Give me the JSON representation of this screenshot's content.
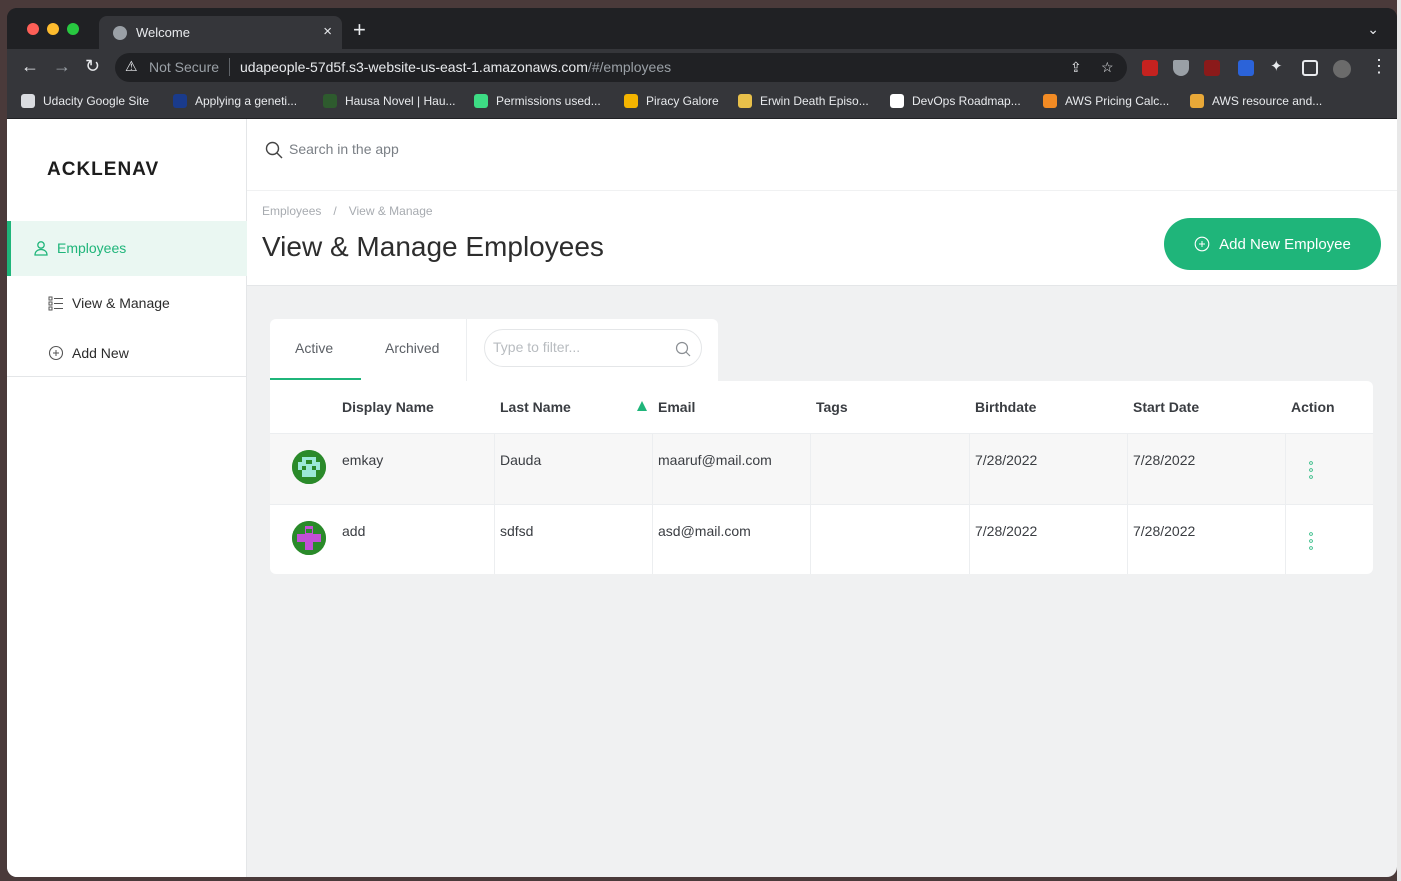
{
  "browser": {
    "tab_title": "Welcome",
    "tab_close": "×",
    "new_tab": "+",
    "security_label": "Not Secure",
    "url_host": "udapeople-57d5f.s3-website-us-east-1.amazonaws.com",
    "url_path": "/#/employees",
    "bookmarks": [
      {
        "label": "Udacity Google Site",
        "color": "#dadce0"
      },
      {
        "label": "Applying a geneti...",
        "color": "#1a3b8c"
      },
      {
        "label": "Hausa Novel | Hau...",
        "color": "#2e5b2e"
      },
      {
        "label": "Permissions used...",
        "color": "#3ddc84"
      },
      {
        "label": "Piracy Galore",
        "color": "#f4b400"
      },
      {
        "label": "Erwin Death Episo...",
        "color": "#e8c04a"
      },
      {
        "label": "DevOps Roadmap...",
        "color": "#ffffff"
      },
      {
        "label": "AWS Pricing Calc...",
        "color": "#f28b24"
      },
      {
        "label": "AWS resource and...",
        "color": "#e8a838"
      }
    ]
  },
  "app": {
    "logo": "ACKLENAV",
    "search_placeholder": "Search in the app",
    "sidebar": {
      "parent": "Employees",
      "items": [
        {
          "label": "View & Manage"
        },
        {
          "label": "Add New"
        }
      ]
    },
    "breadcrumb": [
      "Employees",
      "View & Manage"
    ],
    "breadcrumb_sep": "/",
    "title": "View & Manage Employees",
    "add_button": "Add New Employee",
    "tabs": [
      "Active",
      "Archived"
    ],
    "filter_placeholder": "Type to filter...",
    "table": {
      "columns": [
        "Display Name",
        "Last Name",
        "Email",
        "Tags",
        "Birthdate",
        "Start Date",
        "Action"
      ],
      "sorted_column": "Email",
      "rows": [
        {
          "display_name": "emkay",
          "last_name": "Dauda",
          "email": "maaruf@mail.com",
          "tags": "",
          "birthdate": "7/28/2022",
          "start_date": "7/28/2022"
        },
        {
          "display_name": "add",
          "last_name": "sdfsd",
          "email": "asd@mail.com",
          "tags": "",
          "birthdate": "7/28/2022",
          "start_date": "7/28/2022"
        }
      ]
    },
    "accent_color": "#1fb57a"
  }
}
